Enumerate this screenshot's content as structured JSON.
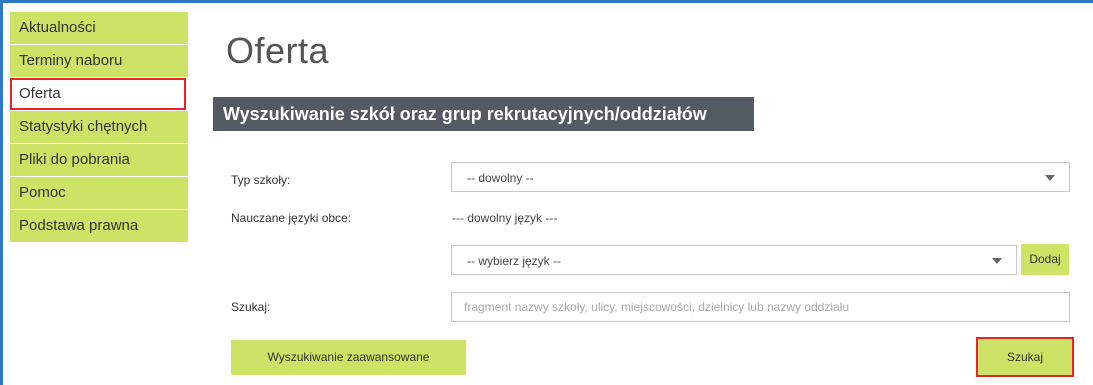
{
  "sidebar": {
    "items": [
      {
        "label": "Aktualności"
      },
      {
        "label": "Terminy naboru"
      },
      {
        "label": "Oferta",
        "active": true
      },
      {
        "label": "Statystyki chętnych"
      },
      {
        "label": "Pliki do pobrania"
      },
      {
        "label": "Pomoc"
      },
      {
        "label": "Podstawa prawna"
      }
    ]
  },
  "main": {
    "title": "Oferta",
    "section_title": "Wyszukiwanie szkół oraz grup rekrutacyjnych/oddziałów"
  },
  "form": {
    "school_type": {
      "label": "Typ szkoły:",
      "value": "-- dowolny --"
    },
    "languages": {
      "label": "Nauczane języki obce:",
      "any_text": "--- dowolny język ---",
      "select_value": "-- wybierz język --",
      "add_label": "Dodaj"
    },
    "search": {
      "label": "Szukaj:",
      "placeholder": "fragment nazwy szkoły, ulicy, miejscowości, dzielnicy lub nazwy oddziału"
    },
    "advanced_label": "Wyszukiwanie zaawansowane",
    "submit_label": "Szukaj"
  },
  "colors": {
    "accent_green": "#cde366",
    "header_gray": "#545a63",
    "highlight_red": "#e0262b",
    "frame_blue": "#2f78c8"
  }
}
